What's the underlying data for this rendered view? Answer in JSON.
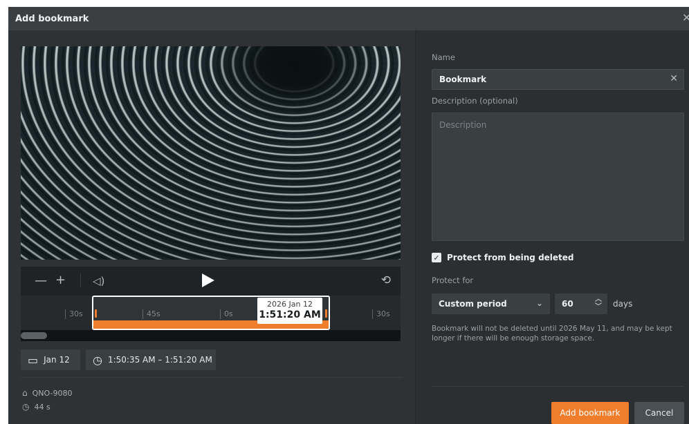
{
  "dialog": {
    "title": "Add bookmark",
    "close_icon": "close-icon"
  },
  "player": {
    "controls": {
      "zoom_out_icon": "minus-icon",
      "zoom_in_icon": "plus-icon",
      "volume_icon": "volume-icon",
      "play_icon": "play-icon",
      "loop_icon": "loop-icon"
    },
    "timeline": {
      "ticks": [
        "30s",
        "45s",
        "0s",
        "30s"
      ],
      "tooltip_date": "2026 Jan 12",
      "tooltip_time": "1:51:20 AM"
    },
    "date_button": "Jan 12",
    "range_button": "1:50:35 AM – 1:51:20 AM"
  },
  "meta": {
    "camera": "QNO-9080",
    "duration": "44 s"
  },
  "form": {
    "name_label": "Name",
    "name_value": "Bookmark",
    "description_label": "Description (optional)",
    "description_placeholder": "Description",
    "protect_label": "Protect from being deleted",
    "protect_checked": true,
    "protect_for_label": "Protect for",
    "period_value": "Custom period",
    "days_value": "60",
    "days_unit": "days",
    "note": "Bookmark will not be deleted until 2026 May 11, and may be kept longer if there will be enough storage space."
  },
  "actions": {
    "primary": "Add bookmark",
    "cancel": "Cancel"
  },
  "colors": {
    "accent": "#f07d2c",
    "panel_bg": "#2e3235"
  }
}
